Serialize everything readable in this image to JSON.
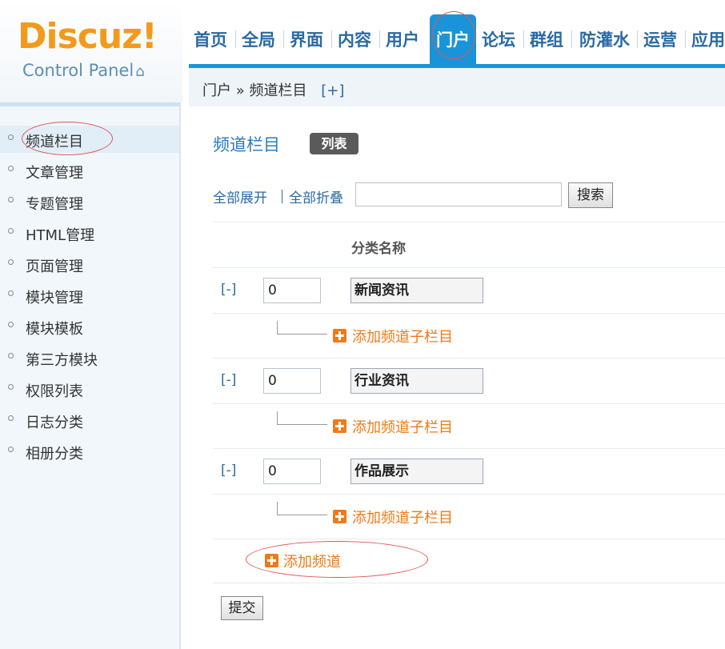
{
  "logo": {
    "brand": "Discuz!",
    "subtitle": "Control Panel",
    "home_glyph": "⌂"
  },
  "topnav": {
    "items": [
      "首页",
      "全局",
      "界面",
      "内容",
      "用户",
      "门户",
      "论坛",
      "群组",
      "防灌水",
      "运营",
      "应用"
    ],
    "active": "门户"
  },
  "breadcrumb": {
    "section": "门户",
    "separator": "»",
    "page": "频道栏目",
    "add_label": "[+]"
  },
  "sidebar": {
    "items": [
      {
        "label": "频道栏目",
        "active": true
      },
      {
        "label": "文章管理",
        "active": false
      },
      {
        "label": "专题管理",
        "active": false
      },
      {
        "label": "HTML管理",
        "active": false
      },
      {
        "label": "页面管理",
        "active": false
      },
      {
        "label": "模块管理",
        "active": false
      },
      {
        "label": "模块模板",
        "active": false
      },
      {
        "label": "第三方模块",
        "active": false
      },
      {
        "label": "权限列表",
        "active": false
      },
      {
        "label": "日志分类",
        "active": false
      },
      {
        "label": "相册分类",
        "active": false
      }
    ]
  },
  "main": {
    "title": "频道栏目",
    "view_badge": "列表",
    "expand_all": "全部展开",
    "collapse_all": "全部折叠",
    "search": {
      "value": "",
      "button_label": "搜索"
    },
    "column_header": "分类名称",
    "categories": [
      {
        "toggle": "[-]",
        "order": "0",
        "name": "新闻资讯",
        "add_sub_label": "添加频道子栏目"
      },
      {
        "toggle": "[-]",
        "order": "0",
        "name": "行业资讯",
        "add_sub_label": "添加频道子栏目"
      },
      {
        "toggle": "[-]",
        "order": "0",
        "name": "作品展示",
        "add_sub_label": "添加频道子栏目"
      }
    ],
    "add_channel_label": "添加频道",
    "submit_label": "提交"
  },
  "colors": {
    "brand_orange": "#f39a1c",
    "nav_blue": "#1a94d8",
    "link_blue": "#2a6aa3",
    "add_orange": "#f07a17",
    "annotation_red": "#e05555"
  }
}
